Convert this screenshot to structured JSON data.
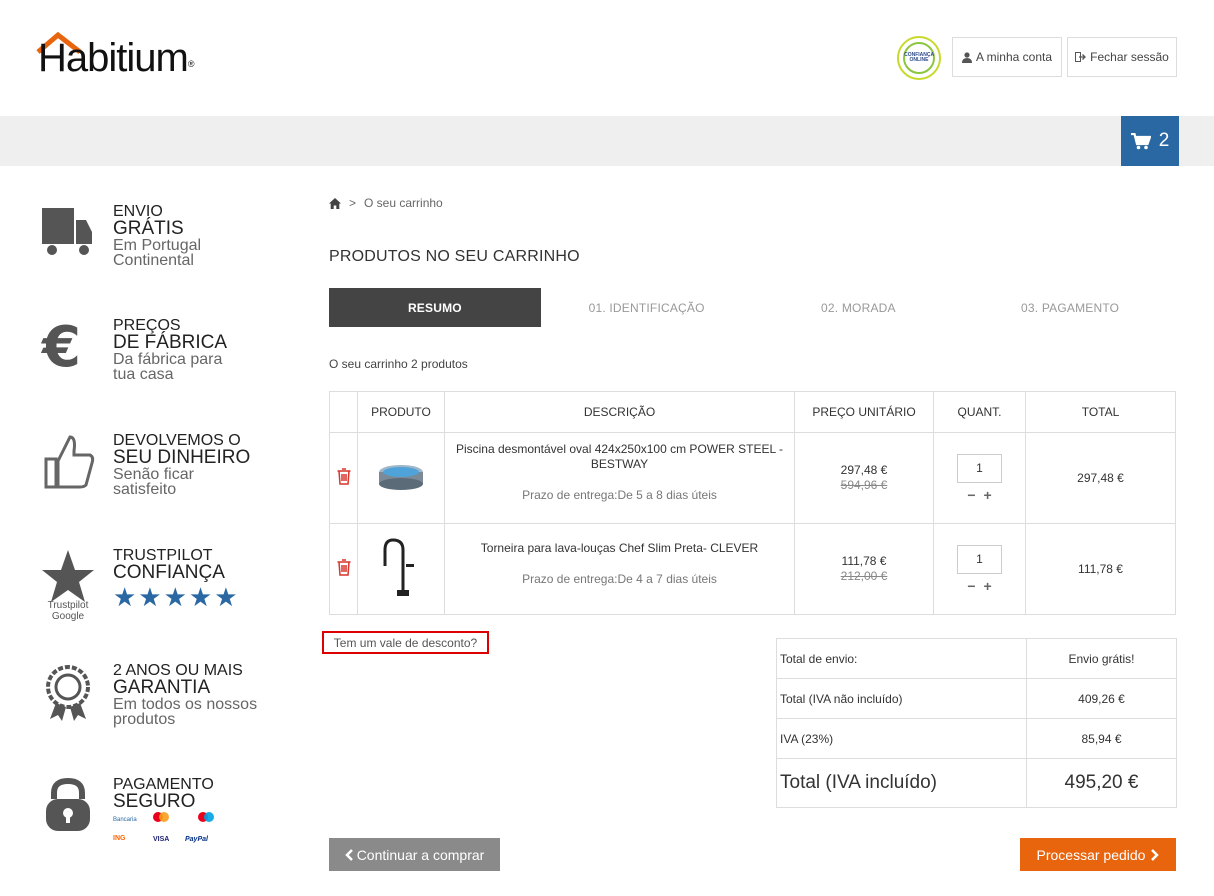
{
  "header": {
    "logo_text": "Habitium",
    "logo_reg": "®",
    "trust_badge_text": "CONFIANÇA ONLINE",
    "account_label": "A minha conta",
    "logout_label": "Fechar sessão",
    "cart_count": "2"
  },
  "sidebar": {
    "features": [
      {
        "l1": "ENVIO",
        "l2": "GRÁTIS",
        "l3a": "Em Portugal",
        "l3b": "Continental",
        "icon": "truck-icon"
      },
      {
        "l1": "PREÇOS",
        "l2": "DE FÁBRICA",
        "l3a": "Da fábrica para",
        "l3b": "tua casa",
        "icon": "euro-icon"
      },
      {
        "l1": "DEVOLVEMOS O",
        "l2": "SEU DINHEIRO",
        "l3a": "Senão ficar",
        "l3b": "satisfeito",
        "icon": "thumbs-up-icon"
      },
      {
        "l1": "TRUSTPILOT",
        "l2": "CONFIANÇA",
        "l3a": "★★★★★",
        "l3b": "",
        "icon": "star-icon",
        "sub_a": "Trustpilot",
        "sub_b": "Google"
      },
      {
        "l1": "2 ANOS OU MAIS",
        "l2": "GARANTIA",
        "l3a": "Em todos os nossos",
        "l3b": "produtos",
        "icon": "award-icon"
      },
      {
        "l1": "PAGAMENTO",
        "l2": "SEGURO",
        "l3a": "",
        "l3b": "",
        "icon": "lock-icon",
        "pay_a": "Bancaria",
        "pay_b": "ING",
        "pay_c": "VISA",
        "pay_d": "PayPal"
      }
    ]
  },
  "breadcrumb": {
    "separator": ">",
    "current": "O seu carrinho"
  },
  "page_title": "PRODUTOS NO SEU CARRINHO",
  "steps": [
    "RESUMO",
    "01. IDENTIFICAÇÃO",
    "02. MORADA",
    "03. PAGAMENTO"
  ],
  "cart_summary": "O seu carrinho 2 produtos",
  "table": {
    "headers": [
      "PRODUTO",
      "DESCRIÇÃO",
      "PREÇO UNITÁRIO",
      "QUANT.",
      "TOTAL"
    ],
    "rows": [
      {
        "name": "Piscina desmontável oval 424x250x100 cm POWER STEEL - BESTWAY",
        "delivery": "Prazo de entrega:De 5 a 8 dias úteis",
        "price": "297,48 €",
        "old_price": "594,96 €",
        "qty": "1",
        "total": "297,48 €"
      },
      {
        "name": "Torneira para lava-louças Chef Slim Preta- CLEVER",
        "delivery": "Prazo de entrega:De 4 a 7 dias úteis",
        "price": "111,78 €",
        "old_price": "212,00 €",
        "qty": "1",
        "total": "111,78 €"
      }
    ],
    "qty_minus": "−",
    "qty_plus": "+"
  },
  "discount_link": "Tem um vale de desconto?",
  "totals": {
    "shipping_label": "Total de envio:",
    "shipping_value": "Envio grátis!",
    "net_label": "Total (IVA não incluído)",
    "net_value": "409,26 €",
    "vat_label": "IVA (23%)",
    "vat_value": "85,94 €",
    "grand_label": "Total (IVA incluído)",
    "grand_value": "495,20 €"
  },
  "buttons": {
    "continue": "Continuar a comprar",
    "process": "Processar pedido"
  },
  "colors": {
    "cart_blue": "#2a68a3",
    "accent_orange": "#e8650e",
    "step_active": "#444444",
    "discount_border": "#dd0000",
    "delete_red": "#d9342b"
  }
}
